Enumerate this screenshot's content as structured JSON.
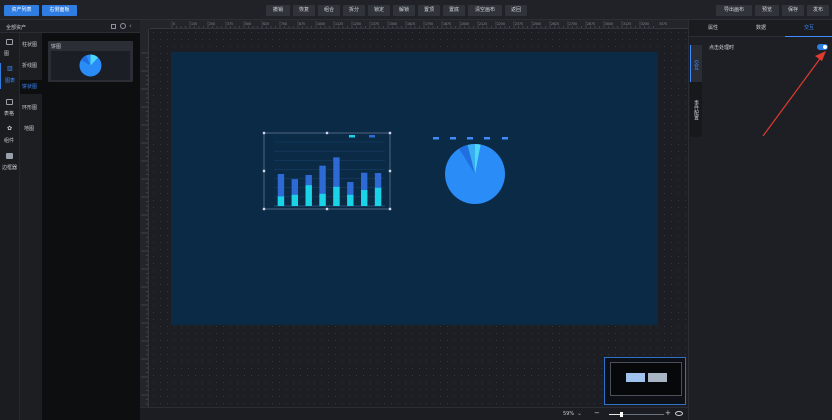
{
  "toolbar": {
    "left_buttons": [
      "资产列表",
      "右侧面板"
    ],
    "center_buttons": [
      "撤销",
      "恢复",
      "组合",
      "拆分",
      "锁定",
      "解锁",
      "置顶",
      "置底",
      "清空画布",
      "返回"
    ],
    "right_buttons": [
      "导出画布",
      "预览",
      "保存",
      "发布"
    ]
  },
  "left_panel": {
    "title": "全部资产",
    "icon_items": [
      "图表",
      "表格",
      "组件",
      "边框器"
    ],
    "icon_first": "图",
    "categories": [
      "柱状图",
      "折线图",
      "饼状图",
      "环形图",
      "地图"
    ],
    "asset_card_title": "饼图"
  },
  "ruler": {
    "h_ticks": [
      "0",
      "130",
      "250",
      "375",
      "500",
      "625",
      "750",
      "875",
      "1000",
      "1125",
      "1250",
      "1375",
      "1500",
      "1625",
      "1750",
      "1875",
      "2000",
      "2125",
      "2250",
      "2375",
      "2500",
      "2625",
      "2750",
      "2875",
      "3000",
      "3125",
      "3250",
      "3375"
    ]
  },
  "bottom": {
    "zoom": "59%",
    "minus": "−",
    "plus": "+"
  },
  "right_panel": {
    "tabs": [
      "属性",
      "数据",
      "交互"
    ],
    "active_tab": 2,
    "side_tabs": [
      "交互",
      "事件配置"
    ],
    "setting_label": "点击处理时",
    "toggle_on": true
  },
  "colors": {
    "accent": "#2f7de1",
    "canvas_bg": "#0b2a46",
    "bar_dark": "#2d6ad6",
    "bar_light": "#19d3e6",
    "pie_main": "#2a8cf7",
    "pie_slice": "#4fd5f6",
    "arrow": "#e03a2f"
  },
  "chart_data": [
    {
      "type": "bar",
      "categories": [
        "",
        "",
        "",
        "",
        "",
        "",
        "",
        ""
      ],
      "series": [
        {
          "values": [
            100,
            84,
            97,
            126,
            152,
            75,
            104,
            103
          ]
        },
        {
          "values": [
            30,
            35,
            65,
            38,
            60,
            35,
            50,
            57
          ]
        }
      ],
      "legend": [
        "",
        ""
      ],
      "ylim": [
        0,
        200
      ],
      "yticks": [
        "",
        "",
        "",
        "",
        "",
        "",
        "",
        ""
      ],
      "grid": true
    },
    {
      "type": "pie",
      "values": [
        88,
        5,
        4,
        3
      ],
      "legend": [
        "",
        "",
        "",
        "",
        ""
      ]
    }
  ]
}
